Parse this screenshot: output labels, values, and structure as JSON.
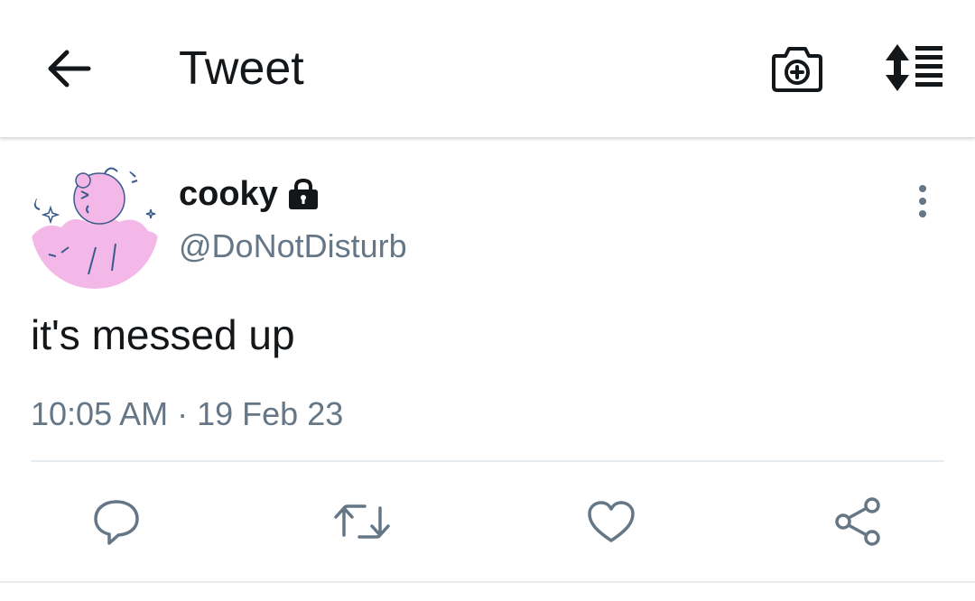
{
  "header": {
    "title": "Tweet",
    "icons": {
      "back": "arrow-left-icon",
      "camera": "camera-plus-icon",
      "sort": "sort-list-icon"
    }
  },
  "tweet": {
    "display_name": "cooky",
    "handle": "@DoNotDisturb",
    "protected": true,
    "text": "it's messed up",
    "time": "10:05 AM",
    "separator": " · ",
    "date": "19 Feb 23"
  },
  "actions": [
    {
      "name": "reply",
      "icon": "reply-icon"
    },
    {
      "name": "retweet",
      "icon": "retweet-icon"
    },
    {
      "name": "like",
      "icon": "heart-icon"
    },
    {
      "name": "share",
      "icon": "share-icon"
    }
  ],
  "colors": {
    "text_primary": "#14171a",
    "text_secondary": "#657786",
    "divider": "#e6ecf0",
    "avatar_pink": "#f4b8e8",
    "avatar_outline": "#3a5a8c"
  }
}
